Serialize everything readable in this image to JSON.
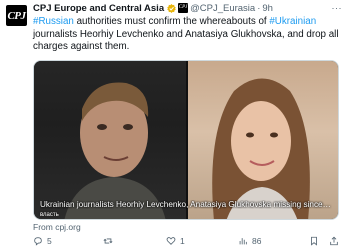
{
  "tweet": {
    "avatar_text": "CPJ",
    "author_name": "CPJ Europe and Central Asia",
    "handle": "@CPJ_Eurasia",
    "separator": "·",
    "time": "9h",
    "more_label": "···",
    "text_parts": {
      "tag1": "#Russian",
      "t1": " authorities must confirm the whereabouts of ",
      "tag2": "#Ukrainian",
      "t2": " journalists Heorhiy Levchenko and Anatasiya Glukhovska, and drop all charges against them."
    },
    "media": {
      "caption": "Ukrainian journalists Heorhiy Levchenko, Anatasiya Glukhovska missing since R...",
      "badge": "власть"
    },
    "source": "From cpj.org",
    "actions": {
      "reply_count": "5",
      "retweet_count": "",
      "like_count": "1",
      "views_count": "86"
    }
  },
  "colors": {
    "accent": "#1d9bf0",
    "verified": "#e8b50a",
    "muted": "#536471"
  },
  "icons": [
    "cpj-logo-icon",
    "verified-badge-icon",
    "more-icon",
    "reply-icon",
    "retweet-icon",
    "like-icon",
    "views-icon",
    "bookmark-icon",
    "share-icon"
  ]
}
